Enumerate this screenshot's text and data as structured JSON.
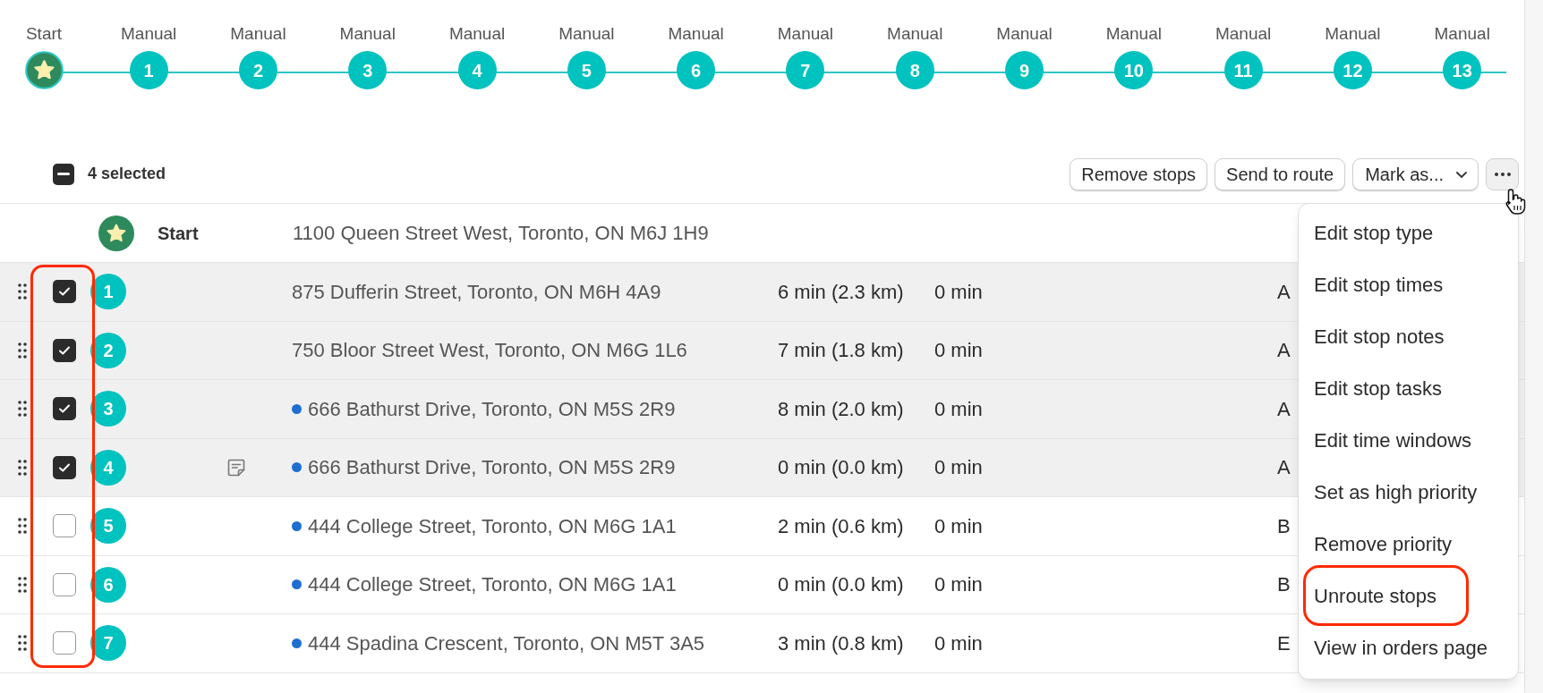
{
  "timeline": [
    {
      "label": "Start",
      "kind": "start"
    },
    {
      "label": "Manual",
      "kind": "stop",
      "number": "1"
    },
    {
      "label": "Manual",
      "kind": "stop",
      "number": "2"
    },
    {
      "label": "Manual",
      "kind": "stop",
      "number": "3"
    },
    {
      "label": "Manual",
      "kind": "stop",
      "number": "4"
    },
    {
      "label": "Manual",
      "kind": "stop",
      "number": "5"
    },
    {
      "label": "Manual",
      "kind": "stop",
      "number": "6"
    },
    {
      "label": "Manual",
      "kind": "stop",
      "number": "7"
    },
    {
      "label": "Manual",
      "kind": "stop",
      "number": "8"
    },
    {
      "label": "Manual",
      "kind": "stop",
      "number": "9"
    },
    {
      "label": "Manual",
      "kind": "stop",
      "number": "10"
    },
    {
      "label": "Manual",
      "kind": "stop",
      "number": "11"
    },
    {
      "label": "Manual",
      "kind": "stop",
      "number": "12"
    },
    {
      "label": "Manual",
      "kind": "stop",
      "number": "13"
    }
  ],
  "toolbar": {
    "select_all": {
      "indeterminate": true
    },
    "selection_count": "4 selected",
    "actions": [
      {
        "kind": "button",
        "label": "Remove stops"
      },
      {
        "kind": "button",
        "label": "Send to route"
      },
      {
        "kind": "dropdown",
        "label": "Mark as..."
      },
      {
        "kind": "more",
        "expanded": true
      }
    ]
  },
  "start_row": {
    "name": "Start",
    "address": "1100 Queen Street West, Toronto, ON M6J 1H9"
  },
  "table": {
    "checkbox_column_annotated": true,
    "rows": [
      {
        "number": "1",
        "checked": true,
        "note": false,
        "status_dot": false,
        "address": "875 Dufferin Street, Toronto, ON M6H 4A9",
        "drive": "6 min (2.3 km)",
        "wait": "0 min",
        "column_5": "A"
      },
      {
        "number": "2",
        "checked": true,
        "note": false,
        "status_dot": false,
        "address": "750 Bloor Street West, Toronto, ON M6G 1L6",
        "drive": "7 min (1.8 km)",
        "wait": "0 min",
        "column_5": "A"
      },
      {
        "number": "3",
        "checked": true,
        "note": false,
        "status_dot": true,
        "address": "666 Bathurst Drive, Toronto, ON M5S 2R9",
        "drive": "8 min (2.0 km)",
        "wait": "0 min",
        "column_5": "A"
      },
      {
        "number": "4",
        "checked": true,
        "note": true,
        "status_dot": true,
        "address": "666 Bathurst Drive, Toronto, ON M5S 2R9",
        "drive": "0 min (0.0 km)",
        "wait": "0 min",
        "column_5": "A"
      },
      {
        "number": "5",
        "checked": false,
        "note": false,
        "status_dot": true,
        "address": "444 College Street, Toronto, ON M6G 1A1",
        "drive": "2 min (0.6 km)",
        "wait": "0 min",
        "column_5": "B"
      },
      {
        "number": "6",
        "checked": false,
        "note": false,
        "status_dot": true,
        "address": "444 College Street, Toronto, ON M6G 1A1",
        "drive": "0 min (0.0 km)",
        "wait": "0 min",
        "column_5": "B"
      },
      {
        "number": "7",
        "checked": false,
        "note": false,
        "status_dot": true,
        "address": "444 Spadina Crescent, Toronto, ON M5T 3A5",
        "drive": "3 min (0.8 km)",
        "wait": "0 min",
        "column_5": "E"
      }
    ]
  },
  "menu": {
    "items": [
      {
        "label": "Edit stop type",
        "annotated": false
      },
      {
        "label": "Edit stop times",
        "annotated": false
      },
      {
        "label": "Edit stop notes",
        "annotated": false
      },
      {
        "label": "Edit stop tasks",
        "annotated": false
      },
      {
        "label": "Edit time windows",
        "annotated": false
      },
      {
        "label": "Set as high priority",
        "annotated": false
      },
      {
        "label": "Remove priority",
        "annotated": false
      },
      {
        "label": "Unroute stops",
        "annotated": true
      },
      {
        "label": "View in orders page",
        "annotated": false
      }
    ]
  }
}
